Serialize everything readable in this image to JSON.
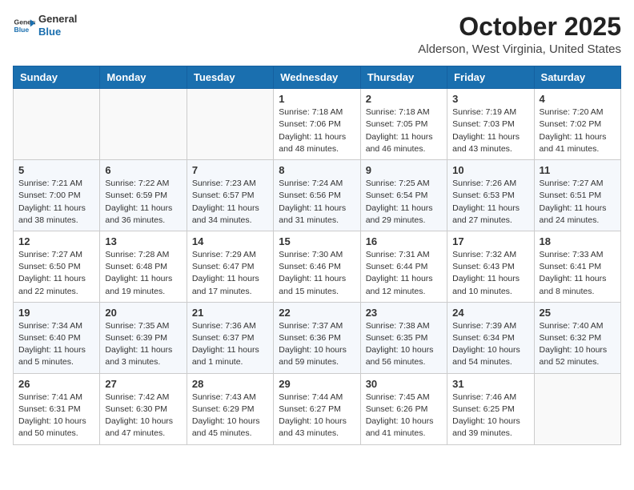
{
  "header": {
    "logo_line1": "General",
    "logo_line2": "Blue",
    "month": "October 2025",
    "location": "Alderson, West Virginia, United States"
  },
  "weekdays": [
    "Sunday",
    "Monday",
    "Tuesday",
    "Wednesday",
    "Thursday",
    "Friday",
    "Saturday"
  ],
  "rows": [
    [
      {
        "day": "",
        "lines": []
      },
      {
        "day": "",
        "lines": []
      },
      {
        "day": "",
        "lines": []
      },
      {
        "day": "1",
        "lines": [
          "Sunrise: 7:18 AM",
          "Sunset: 7:06 PM",
          "Daylight: 11 hours",
          "and 48 minutes."
        ]
      },
      {
        "day": "2",
        "lines": [
          "Sunrise: 7:18 AM",
          "Sunset: 7:05 PM",
          "Daylight: 11 hours",
          "and 46 minutes."
        ]
      },
      {
        "day": "3",
        "lines": [
          "Sunrise: 7:19 AM",
          "Sunset: 7:03 PM",
          "Daylight: 11 hours",
          "and 43 minutes."
        ]
      },
      {
        "day": "4",
        "lines": [
          "Sunrise: 7:20 AM",
          "Sunset: 7:02 PM",
          "Daylight: 11 hours",
          "and 41 minutes."
        ]
      }
    ],
    [
      {
        "day": "5",
        "lines": [
          "Sunrise: 7:21 AM",
          "Sunset: 7:00 PM",
          "Daylight: 11 hours",
          "and 38 minutes."
        ]
      },
      {
        "day": "6",
        "lines": [
          "Sunrise: 7:22 AM",
          "Sunset: 6:59 PM",
          "Daylight: 11 hours",
          "and 36 minutes."
        ]
      },
      {
        "day": "7",
        "lines": [
          "Sunrise: 7:23 AM",
          "Sunset: 6:57 PM",
          "Daylight: 11 hours",
          "and 34 minutes."
        ]
      },
      {
        "day": "8",
        "lines": [
          "Sunrise: 7:24 AM",
          "Sunset: 6:56 PM",
          "Daylight: 11 hours",
          "and 31 minutes."
        ]
      },
      {
        "day": "9",
        "lines": [
          "Sunrise: 7:25 AM",
          "Sunset: 6:54 PM",
          "Daylight: 11 hours",
          "and 29 minutes."
        ]
      },
      {
        "day": "10",
        "lines": [
          "Sunrise: 7:26 AM",
          "Sunset: 6:53 PM",
          "Daylight: 11 hours",
          "and 27 minutes."
        ]
      },
      {
        "day": "11",
        "lines": [
          "Sunrise: 7:27 AM",
          "Sunset: 6:51 PM",
          "Daylight: 11 hours",
          "and 24 minutes."
        ]
      }
    ],
    [
      {
        "day": "12",
        "lines": [
          "Sunrise: 7:27 AM",
          "Sunset: 6:50 PM",
          "Daylight: 11 hours",
          "and 22 minutes."
        ]
      },
      {
        "day": "13",
        "lines": [
          "Sunrise: 7:28 AM",
          "Sunset: 6:48 PM",
          "Daylight: 11 hours",
          "and 19 minutes."
        ]
      },
      {
        "day": "14",
        "lines": [
          "Sunrise: 7:29 AM",
          "Sunset: 6:47 PM",
          "Daylight: 11 hours",
          "and 17 minutes."
        ]
      },
      {
        "day": "15",
        "lines": [
          "Sunrise: 7:30 AM",
          "Sunset: 6:46 PM",
          "Daylight: 11 hours",
          "and 15 minutes."
        ]
      },
      {
        "day": "16",
        "lines": [
          "Sunrise: 7:31 AM",
          "Sunset: 6:44 PM",
          "Daylight: 11 hours",
          "and 12 minutes."
        ]
      },
      {
        "day": "17",
        "lines": [
          "Sunrise: 7:32 AM",
          "Sunset: 6:43 PM",
          "Daylight: 11 hours",
          "and 10 minutes."
        ]
      },
      {
        "day": "18",
        "lines": [
          "Sunrise: 7:33 AM",
          "Sunset: 6:41 PM",
          "Daylight: 11 hours",
          "and 8 minutes."
        ]
      }
    ],
    [
      {
        "day": "19",
        "lines": [
          "Sunrise: 7:34 AM",
          "Sunset: 6:40 PM",
          "Daylight: 11 hours",
          "and 5 minutes."
        ]
      },
      {
        "day": "20",
        "lines": [
          "Sunrise: 7:35 AM",
          "Sunset: 6:39 PM",
          "Daylight: 11 hours",
          "and 3 minutes."
        ]
      },
      {
        "day": "21",
        "lines": [
          "Sunrise: 7:36 AM",
          "Sunset: 6:37 PM",
          "Daylight: 11 hours",
          "and 1 minute."
        ]
      },
      {
        "day": "22",
        "lines": [
          "Sunrise: 7:37 AM",
          "Sunset: 6:36 PM",
          "Daylight: 10 hours",
          "and 59 minutes."
        ]
      },
      {
        "day": "23",
        "lines": [
          "Sunrise: 7:38 AM",
          "Sunset: 6:35 PM",
          "Daylight: 10 hours",
          "and 56 minutes."
        ]
      },
      {
        "day": "24",
        "lines": [
          "Sunrise: 7:39 AM",
          "Sunset: 6:34 PM",
          "Daylight: 10 hours",
          "and 54 minutes."
        ]
      },
      {
        "day": "25",
        "lines": [
          "Sunrise: 7:40 AM",
          "Sunset: 6:32 PM",
          "Daylight: 10 hours",
          "and 52 minutes."
        ]
      }
    ],
    [
      {
        "day": "26",
        "lines": [
          "Sunrise: 7:41 AM",
          "Sunset: 6:31 PM",
          "Daylight: 10 hours",
          "and 50 minutes."
        ]
      },
      {
        "day": "27",
        "lines": [
          "Sunrise: 7:42 AM",
          "Sunset: 6:30 PM",
          "Daylight: 10 hours",
          "and 47 minutes."
        ]
      },
      {
        "day": "28",
        "lines": [
          "Sunrise: 7:43 AM",
          "Sunset: 6:29 PM",
          "Daylight: 10 hours",
          "and 45 minutes."
        ]
      },
      {
        "day": "29",
        "lines": [
          "Sunrise: 7:44 AM",
          "Sunset: 6:27 PM",
          "Daylight: 10 hours",
          "and 43 minutes."
        ]
      },
      {
        "day": "30",
        "lines": [
          "Sunrise: 7:45 AM",
          "Sunset: 6:26 PM",
          "Daylight: 10 hours",
          "and 41 minutes."
        ]
      },
      {
        "day": "31",
        "lines": [
          "Sunrise: 7:46 AM",
          "Sunset: 6:25 PM",
          "Daylight: 10 hours",
          "and 39 minutes."
        ]
      },
      {
        "day": "",
        "lines": []
      }
    ]
  ]
}
